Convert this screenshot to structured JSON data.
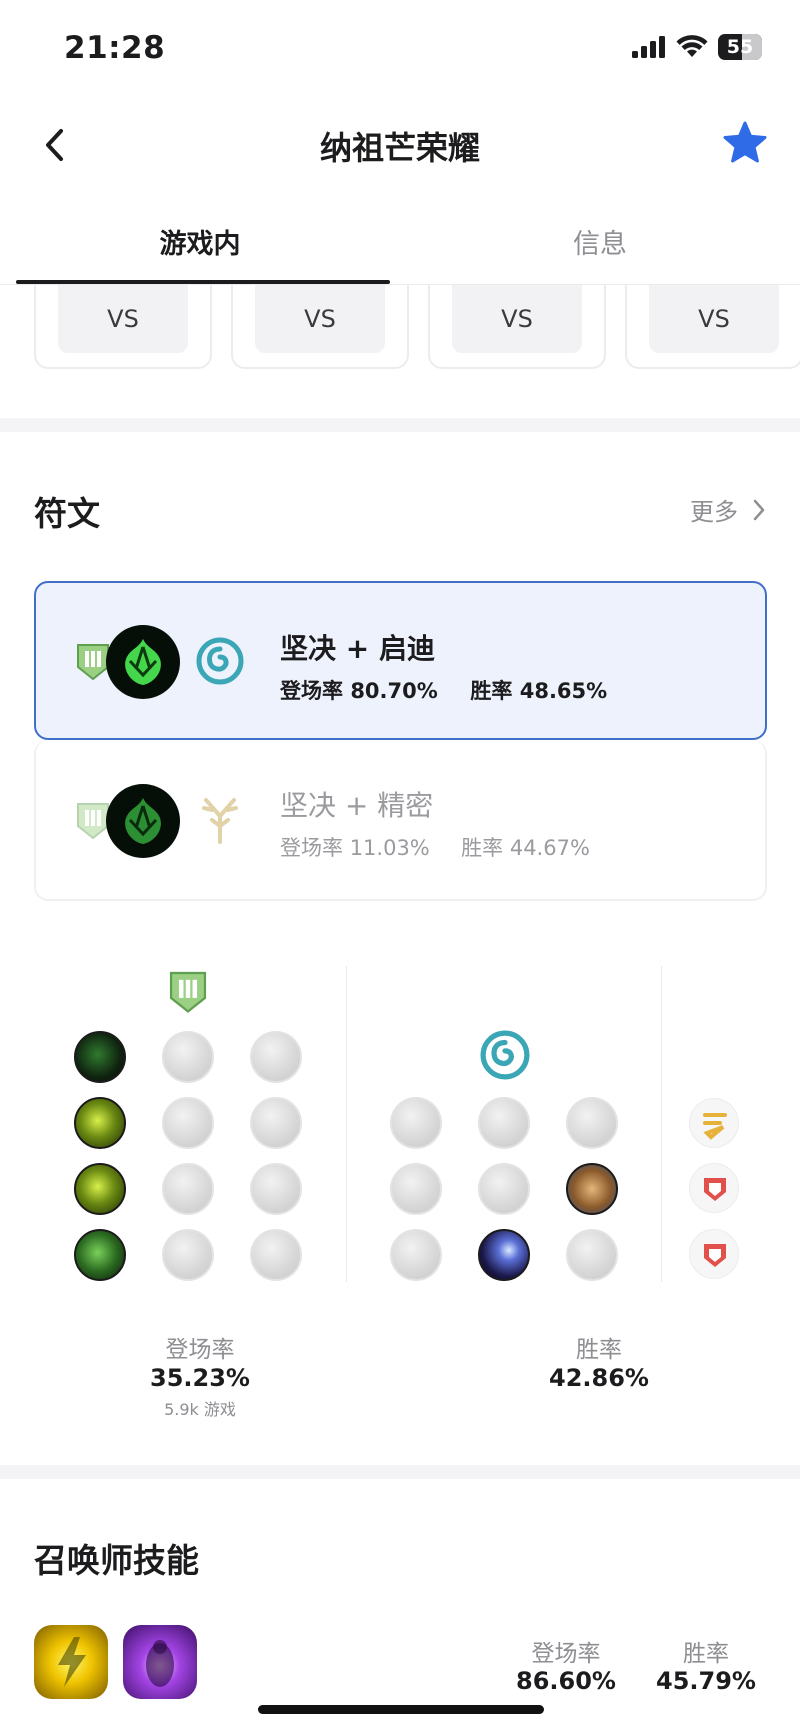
{
  "status_bar": {
    "time": "21:28",
    "battery": "55"
  },
  "nav": {
    "title": "纳祖芒荣耀"
  },
  "tabs": [
    {
      "label": "游戏内",
      "active": true
    },
    {
      "label": "信息",
      "active": false
    }
  ],
  "matchups": [
    {
      "label": "VS"
    },
    {
      "label": "VS"
    },
    {
      "label": "VS"
    },
    {
      "label": "VS"
    }
  ],
  "runes_section": {
    "title": "符文",
    "more_label": "更多",
    "options": [
      {
        "name": "坚决 + 启迪",
        "pick_label": "登场率",
        "pick_value": "80.70%",
        "win_label": "胜率",
        "win_value": "48.65%",
        "selected": true
      },
      {
        "name": "坚决 + 精密",
        "pick_label": "登场率",
        "pick_value": "11.03%",
        "win_label": "胜率",
        "win_value": "44.67%",
        "selected": false
      }
    ],
    "pick_rate_label": "登场率",
    "pick_rate_value": "35.23%",
    "games_count": "5.9k 游戏",
    "win_rate_label": "胜率",
    "win_rate_value": "42.86%"
  },
  "summoner_section": {
    "title": "召唤师技能",
    "pick_rate_label": "登场率",
    "pick_rate_value": "86.60%",
    "win_rate_label": "胜率",
    "win_rate_value": "45.79%"
  },
  "colors": {
    "accent_blue": "#3f6fc9",
    "star": "#2f6be6",
    "resolve_green": "#7fbf6a",
    "inspiration_teal": "#3ba6b5"
  }
}
